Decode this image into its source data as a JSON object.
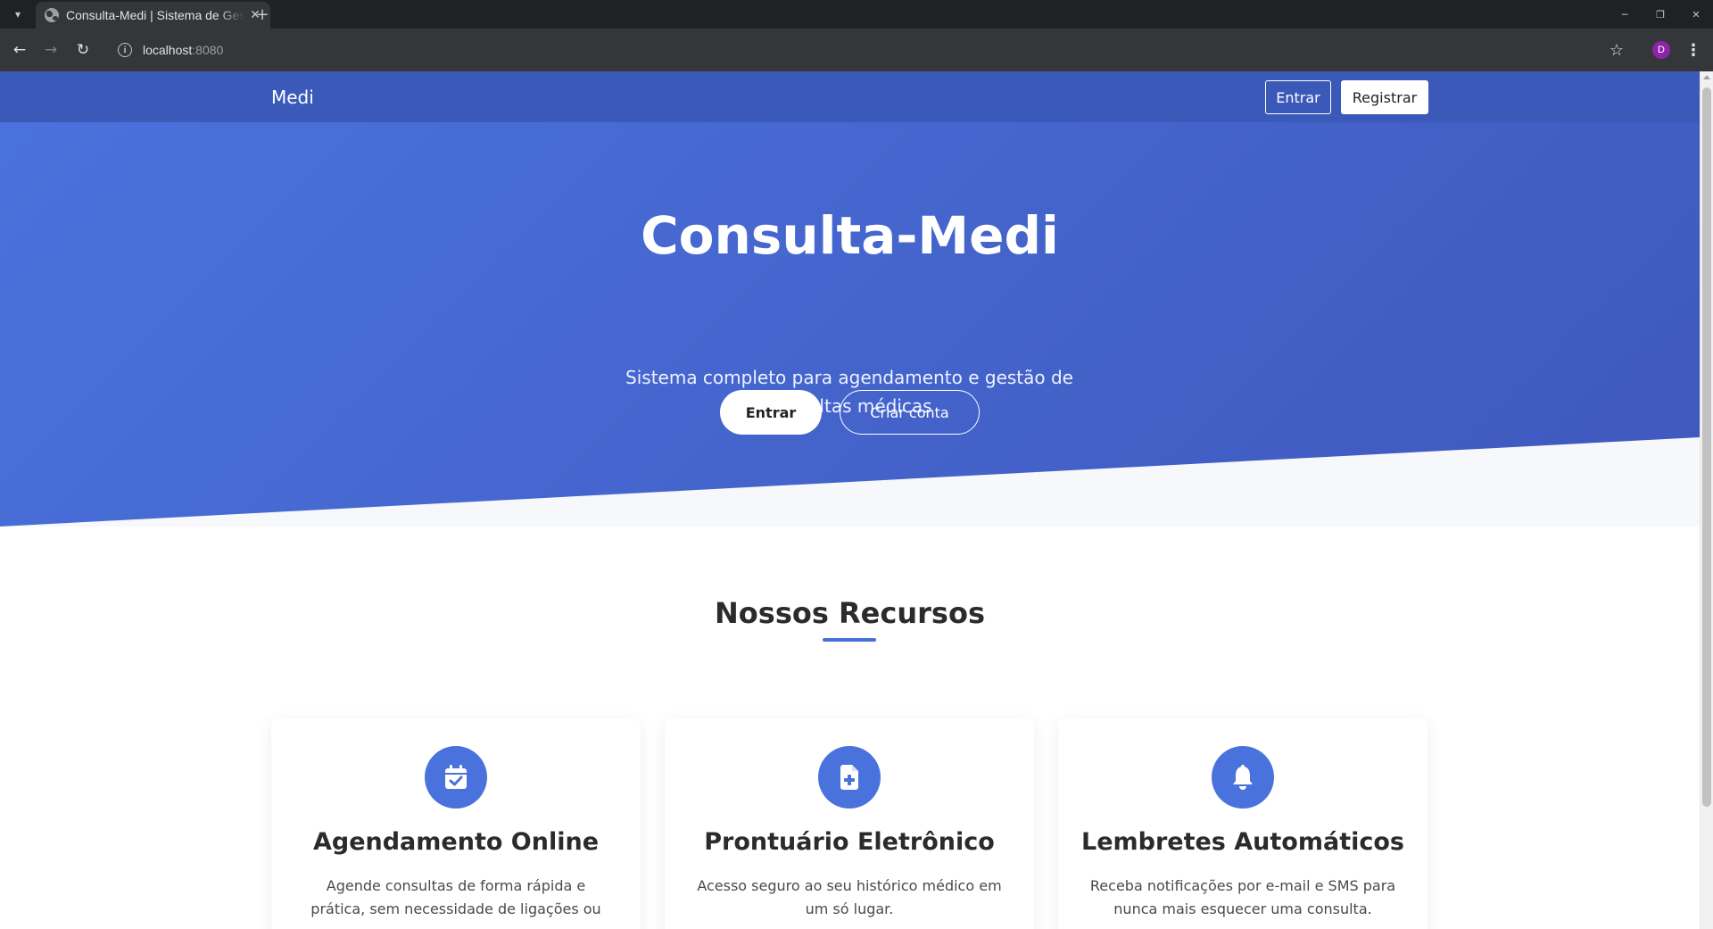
{
  "browser": {
    "tab_title": "Consulta-Medi | Sistema de Gestão",
    "url_host": "localhost",
    "url_port": ":8080",
    "profile_initial": "D"
  },
  "navbar": {
    "brand": "Medi",
    "login_label": "Entrar",
    "register_label": "Registrar"
  },
  "hero": {
    "title": "Consulta-Medi",
    "subtitle": "Sistema completo para agendamento e gestão de consultas médicas",
    "primary_button": "Entrar",
    "secondary_button": "Criar conta"
  },
  "features": {
    "title": "Nossos Recursos",
    "items": [
      {
        "icon": "calendar-check-icon",
        "title": "Agendamento Online",
        "text": "Agende consultas de forma rápida e prática, sem necessidade de ligações ou"
      },
      {
        "icon": "file-medical-icon",
        "title": "Prontuário Eletrônico",
        "text": "Acesso seguro ao seu histórico médico em um só lugar."
      },
      {
        "icon": "bell-icon",
        "title": "Lembretes Automáticos",
        "text": "Receba notificações por e-mail e SMS para nunca mais esquecer uma consulta."
      }
    ]
  },
  "colors": {
    "navbar": "#3b59b8",
    "hero_start": "#4a72dc",
    "hero_end": "#3f58bd",
    "accent": "#4a72dc"
  }
}
